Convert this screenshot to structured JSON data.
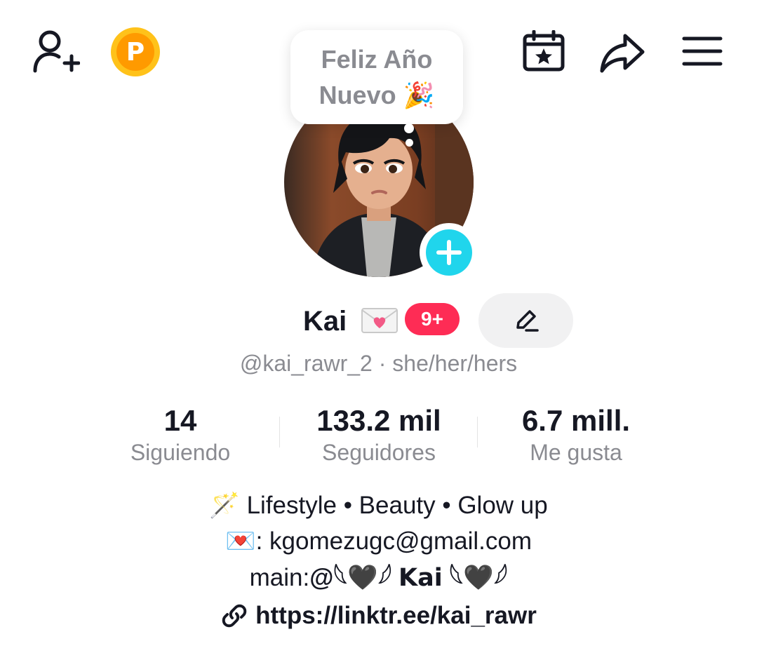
{
  "header": {
    "icons": [
      "add-friend-icon",
      "coin-icon",
      "calendar-star-icon",
      "share-icon",
      "menu-icon"
    ],
    "coin_letter": "P"
  },
  "bubble": {
    "line1": "Feliz Año",
    "line2": "Nuevo 🎉"
  },
  "profile": {
    "name": "Kai",
    "notification_count": "9+",
    "handle_line": "@kai_rawr_2 · she/her/hers"
  },
  "stats": [
    {
      "value": "14",
      "label": "Siguiendo"
    },
    {
      "value": "133.2 mil",
      "label": "Seguidores"
    },
    {
      "value": "6.7 mill.",
      "label": "Me gusta"
    }
  ],
  "bio": {
    "line1": "🪄 Lifestyle • Beauty • Glow up",
    "line2_prefix": "💌: ",
    "line2_email": "kgomezugc@gmail.com",
    "line3_prefix": "main:",
    "line3_handle": "@𓆩🖤𓆪 𝗞𝗮𝗶 𓆩🖤𓆪",
    "link": "https://linktr.ee/kai_rawr"
  },
  "colors": {
    "accent_red": "#FE2C55",
    "accent_cyan": "#20D5EC",
    "coin_gold": "#FFC21A",
    "coin_orange": "#FF9A00",
    "text_secondary": "#8a8b91"
  }
}
